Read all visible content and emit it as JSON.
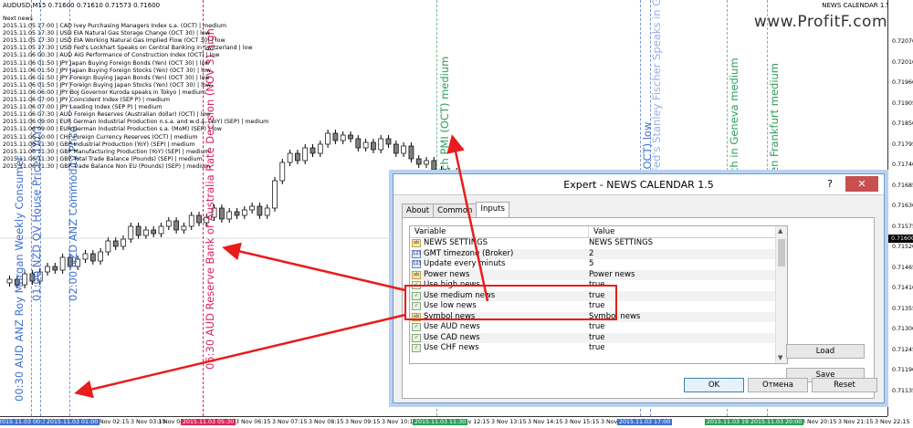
{
  "header": {
    "symbol": "AUDUSD,M15  0.71600 0.71610 0.71573 0.71600",
    "expert": "NEWS CALENDAR 1.5",
    "watermark": "www.ProfitF.com",
    "smiley": "☺"
  },
  "news_list": [
    "Next news",
    "2015.11.05  17:00  | CAD Ivey Purchasing Managers Index s.a. (OCT) | medium",
    "2015.11.05  17:30  | USD EIA Natural Gas Storage Change (OCT 30) | low",
    "2015.11.05  17:30  | USD EIA Working Natural Gas Implied Flow (OCT 30) | low",
    "2015.11.05  17:30  | USD Fed's Lockhart Speaks on Central Banking in Switzerland | low",
    "2015.11.06  00:30  | AUD AiG Performance of Construction Index (OCT) | low",
    "2015.11.06  01:50  | JPY Japan Buying Foreign Bonds (Yen) (OCT 30) | low",
    "2015.11.06  01:50  | JPY Japan Buying Foreign Stocks (Yen) (OCT 30) | low",
    "2015.11.06  01:50  | JPY Foreign Buying Japan Bonds (Yen) (OCT 30) | low",
    "2015.11.06  01:50  | JPY Foreign Buying Japan Stocks (Yen) (OCT 30) | low",
    "2015.11.06  06:00  | JPY BoJ Governor Kuroda speaks in Tokyo | medium",
    "2015.11.06  07:00  | JPY Coincident Index (SEP P) | medium",
    "2015.11.06  07:00  | JPY Leading Index (SEP P) | medium",
    "2015.11.06  07:30  | AUD Foreign Reserves (Australian dollar) (OCT) | low",
    "2015.11.06  09:00  | EUR German Industrial Production n.s.a. and w.d.a. (YoY) (SEP) | medium",
    "2015.11.06  09:00  | EUR German Industrial Production s.a. (MoM) (SEP) | low",
    "2015.11.06  10:00  | CHF Foreign Currency Reserves (OCT) | medium",
    "2015.11.06  11:30  | GBP Industrial Production (YoY) (SEP) | medium",
    "2015.11.06  11:30  | GBP Manufacturing Production (YoY) (SEP) | medium",
    "2015.11.06  11:30  | GBP Total Trade Balance (Pounds) (SEP) | medium",
    "2015.11.06  11:30  | GBP Trade Balance Non EU (Pounds) (SEP) | medium"
  ],
  "price_scale": [
    "0.72070",
    "0.72010",
    "0.71960",
    "0.71905",
    "0.71850",
    "0.71795",
    "0.71740",
    "0.71685",
    "0.71630",
    "0.71575",
    "0.71520",
    "0.71465",
    "0.71410",
    "0.71355",
    "0.71300",
    "0.71245",
    "0.71190",
    "0.71135"
  ],
  "current_price": "0.71600",
  "time_scale": {
    "labels": [
      {
        "text": "3 Nov 02:15"
      },
      {
        "text": "3 Nov 03:15"
      },
      {
        "text": "3 Nov 04:15"
      },
      {
        "text": "3 Nov 06:15"
      },
      {
        "text": "3 Nov 07:15"
      },
      {
        "text": "3 Nov 08:15"
      },
      {
        "text": "3 Nov 09:15"
      },
      {
        "text": "3 Nov 10:15"
      },
      {
        "text": "3 Nov 12:15"
      },
      {
        "text": "3 Nov 13:15"
      },
      {
        "text": "3 Nov 14:15"
      },
      {
        "text": "3 Nov 15:15"
      },
      {
        "text": "3 Nov 16:15"
      },
      {
        "text": "3 Nov 18:15"
      },
      {
        "text": "3 Nov 19:15"
      },
      {
        "text": "3 Nov 20:15"
      },
      {
        "text": "3 Nov 21:15"
      },
      {
        "text": "3 Nov 22:15"
      }
    ],
    "flags": [
      {
        "text": "2015.11.03 00:30",
        "color": "#3f6fd0"
      },
      {
        "text": "2015.11.03 01:00",
        "color": "#3f6fd0"
      },
      {
        "text": "2015.11.03 05:30",
        "color": "#d9245a"
      },
      {
        "text": "2015.11.03 11:30",
        "color": "#2e9e5b"
      },
      {
        "text": "2015.11.03 17:00",
        "color": "#3f6fd0"
      },
      {
        "text": "2015.11.03 19:30",
        "color": "#2e9e5b"
      },
      {
        "text": "2015.11.03 20:00",
        "color": "#2e9e5b"
      }
    ]
  },
  "event_labels": [
    {
      "text": "00:30 AUD ANZ Roy Morgan Weekly Consumer",
      "color": "#3f6fd0"
    },
    {
      "text": "01:00 NZD QV House Prices (YoY)",
      "color": "#3f6fd0"
    },
    {
      "text": "02:00 NZD ANZ Commodity Price",
      "color": "#3f6fd0"
    },
    {
      "text": "05:30 AUD Reserve Bank of Australia Rate Decision (NOV 3) high",
      "color": "#d9245a"
    },
    {
      "text": "ich PMI (OCT) medium",
      "color": "#2e9e5b"
    },
    {
      "text": "(OCT) low",
      "color": "#3f6fd0"
    },
    {
      "text": "Fed's Stanley Fischer Speaks in Geneva medium",
      "color": "#2e9e5b"
    },
    {
      "text": "ch in Geneva medium",
      "color": "#2e9e5b"
    },
    {
      "text": "en Frankfurt medium",
      "color": "#2e9e5b"
    }
  ],
  "dialog": {
    "title": "Expert - NEWS CALENDAR 1.5",
    "help": "?",
    "close": "✕",
    "tabs": [
      "About",
      "Common",
      "Inputs"
    ],
    "active_tab": "Inputs",
    "columns": {
      "variable": "Variable",
      "value": "Value"
    },
    "rows": [
      {
        "icon": "ab",
        "icon_text": "ab",
        "variable": "NEWS SETTINGS",
        "value": "NEWS SETTINGS"
      },
      {
        "icon": "num",
        "icon_text": "123",
        "variable": "GMT timezone (Broker)",
        "value": "2"
      },
      {
        "icon": "num",
        "icon_text": "123",
        "variable": "Update every minuts",
        "value": "5"
      },
      {
        "icon": "ab",
        "icon_text": "ab",
        "variable": "Power news",
        "value": "Power news"
      },
      {
        "icon": "bool",
        "icon_text": "✓",
        "variable": "Use high news",
        "value": "true"
      },
      {
        "icon": "bool",
        "icon_text": "✓",
        "variable": "Use medium news",
        "value": "true"
      },
      {
        "icon": "bool",
        "icon_text": "✓",
        "variable": "Use low news",
        "value": "true"
      },
      {
        "icon": "ab",
        "icon_text": "ab",
        "variable": "Symbol news",
        "value": "Symbol news"
      },
      {
        "icon": "bool",
        "icon_text": "✓",
        "variable": "Use AUD news",
        "value": "true"
      },
      {
        "icon": "bool",
        "icon_text": "✓",
        "variable": "Use CAD news",
        "value": "true"
      },
      {
        "icon": "bool",
        "icon_text": "✓",
        "variable": "Use CHF news",
        "value": "true"
      }
    ],
    "buttons": {
      "load": "Load",
      "save": "Save",
      "ok": "OK",
      "cancel": "Отмена",
      "reset": "Reset"
    }
  },
  "colors": {
    "highlight": "#e81c1c",
    "candle_up": "#ffffff",
    "candle_down": "#7f7f7f"
  }
}
